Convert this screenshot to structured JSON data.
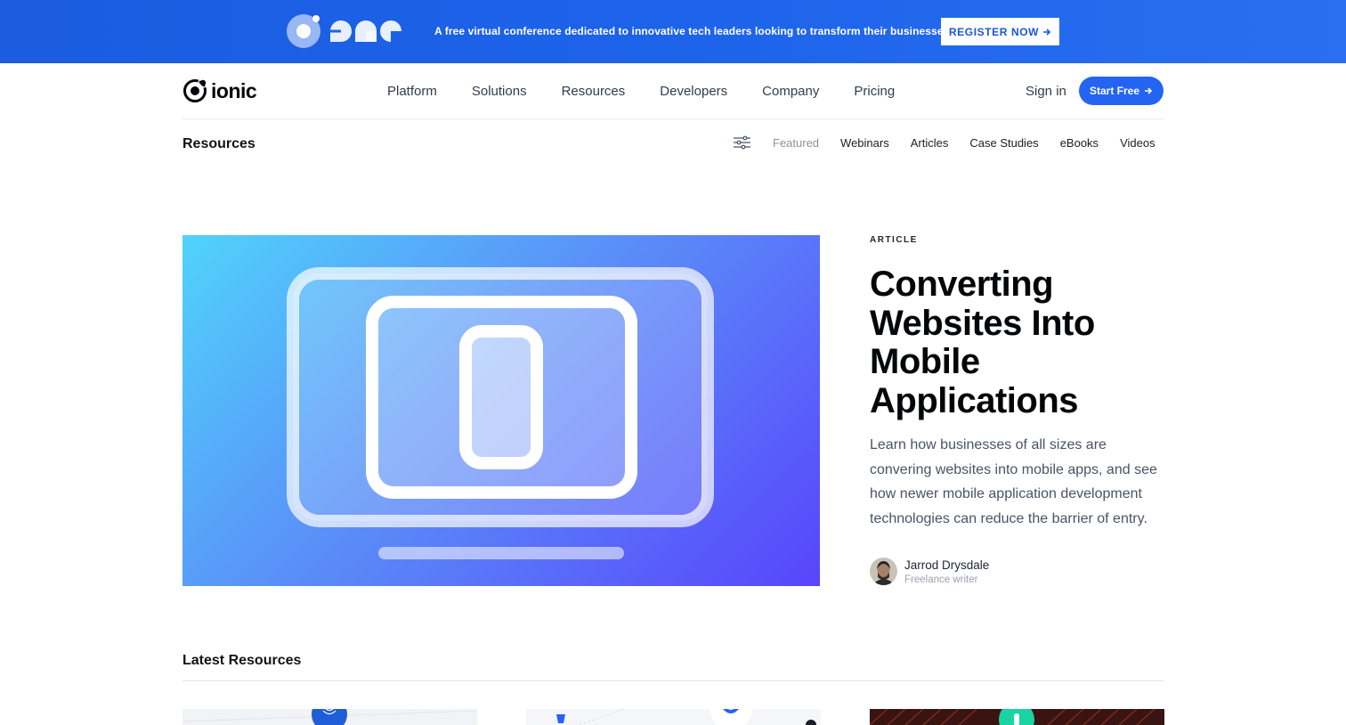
{
  "banner": {
    "text": "A free virtual conference dedicated to innovative tech leaders looking to transform their businesses.",
    "cta": "REGISTER NOW",
    "cta_icon": "arrow-right-icon",
    "logo_icon": "conference-logo-icon"
  },
  "nav": {
    "logo_text": "ionic",
    "links": [
      "Platform",
      "Solutions",
      "Resources",
      "Developers",
      "Company",
      "Pricing"
    ],
    "signin": "Sign in",
    "start": "Start Free",
    "start_icon": "arrow-right-icon"
  },
  "subnav": {
    "title": "Resources",
    "filter_icon": "sliders-icon",
    "links": [
      "Featured",
      "Webinars",
      "Articles",
      "Case Studies",
      "eBooks",
      "Videos"
    ]
  },
  "hero": {
    "kicker": "ARTICLE",
    "title": "Converting Websites Into Mobile Applications",
    "description": "Learn how businesses of all sizes are convering websites into mobile apps, and see how newer mobile application development technologies can reduce the barrier of entry.",
    "author_name": "Jarrod Drysdale",
    "author_role": "Freelance writer",
    "illustration_icon": "monitor-tablet-phone-icon"
  },
  "latest": {
    "title": "Latest Resources"
  },
  "colors": {
    "accent": "#2464f2",
    "banner": "#1d63ea"
  }
}
